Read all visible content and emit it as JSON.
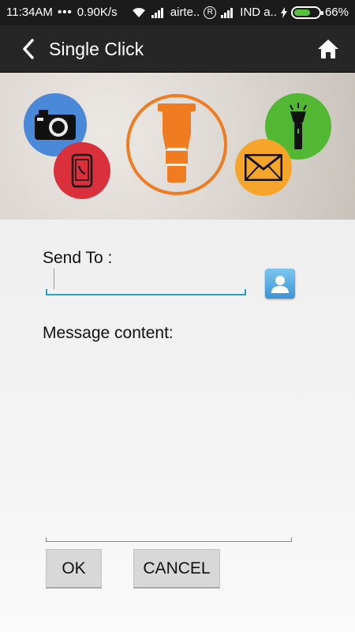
{
  "status_bar": {
    "time": "11:34AM",
    "dots": "•••",
    "speed": "0.90K/s",
    "carrier1": "airte..",
    "carrier2": "IND a..",
    "battery_percent": "66%",
    "battery_level": 0.66,
    "registered_symbol": "R"
  },
  "app_bar": {
    "title": "Single Click",
    "back_icon": "back-chevron",
    "home_icon": "home"
  },
  "banner": {
    "icons": [
      "camera-icon",
      "phone-icon",
      "torch-icon",
      "flashlight-icon",
      "mail-icon"
    ],
    "colors": {
      "camera_circle": "#4a88d8",
      "phone_circle": "#d9303c",
      "torch_ring": "#f07c22",
      "flashlight_circle": "#52b833",
      "mail_circle": "#f5a62a"
    }
  },
  "form": {
    "send_to_label": "Send To :",
    "send_to_value": "",
    "message_label": "Message content:",
    "message_value": "",
    "ok_label": "OK",
    "cancel_label": "CANCEL"
  },
  "colors": {
    "input_accent": "#2aa0c5",
    "app_bar_bg": "#262626",
    "status_bar_bg": "#1b1b1b",
    "battery_fill": "#56c13c"
  }
}
